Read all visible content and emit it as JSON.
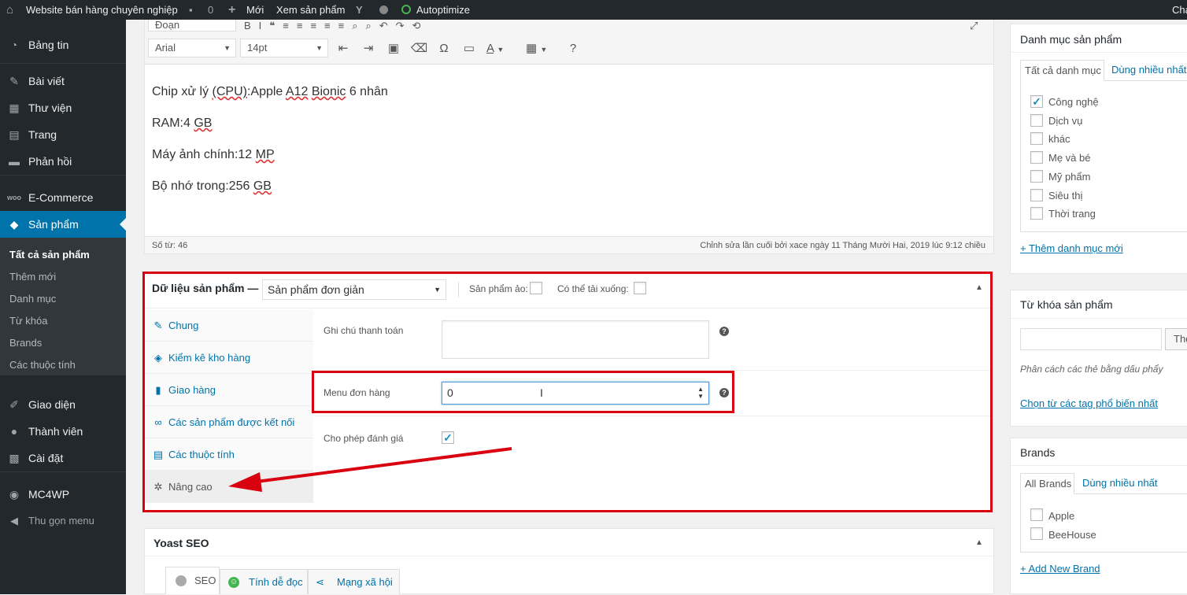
{
  "adminbar": {
    "site_name": "Website bán hàng chuyên nghiệp",
    "comments": "0",
    "new": "Mới",
    "view": "Xem sản phẩm",
    "autoptimize": "Autoptimize",
    "right": "Cha"
  },
  "sidebar": {
    "items": [
      {
        "label": "Bảng tin",
        "icon": "dashboard-icon"
      },
      {
        "label": "Bài viết",
        "icon": "pin-icon"
      },
      {
        "label": "Thư viện",
        "icon": "media-icon"
      },
      {
        "label": "Trang",
        "icon": "page-icon"
      },
      {
        "label": "Phản hồi",
        "icon": "comment-icon"
      },
      {
        "label": "E-Commerce",
        "icon": "woo-icon"
      },
      {
        "label": "Sản phẩm",
        "icon": "cube-icon"
      },
      {
        "label": "Giao diện",
        "icon": "brush-icon"
      },
      {
        "label": "Thành viên",
        "icon": "user-icon"
      },
      {
        "label": "Cài đặt",
        "icon": "settings-icon"
      },
      {
        "label": "MC4WP",
        "icon": "mc4wp-icon"
      },
      {
        "label": "Thu gọn menu",
        "icon": "collapse-icon"
      }
    ],
    "submenu": [
      "Tất cả sản phẩm",
      "Thêm mới",
      "Danh mục",
      "Từ khóa",
      "Brands",
      "Các thuộc tính"
    ]
  },
  "editor": {
    "format": "Đoạn",
    "font": "Arial",
    "size": "14pt",
    "lines": [
      {
        "pre": "Chip xử lý ",
        "u1": "(CPU)",
        "mid": ":Apple ",
        "u2": "A12",
        "sp": " ",
        "u3": "Bionic",
        "post": " 6 nhân"
      },
      {
        "pre": "RAM:4 ",
        "u1": "GB"
      },
      {
        "pre": "Máy ảnh chính:12 ",
        "u1": "MP"
      },
      {
        "pre": "Bộ nhớ trong:256 ",
        "u1": "GB"
      }
    ],
    "word_count": "Số từ: 46",
    "last_edit": "Chỉnh sửa lần cuối bởi xace ngày 11 Tháng Mười Hai, 2019 lúc 9:12 chiều"
  },
  "product_data": {
    "title": "Dữ liệu sản phẩm —",
    "type": "Sản phẩm đơn giản",
    "virtual": "Sản phẩm ảo:",
    "downloadable": "Có thể tải xuống:",
    "tabs": [
      "Chung",
      "Kiểm kê kho hàng",
      "Giao hàng",
      "Các sản phẩm được kết nối",
      "Các thuộc tính",
      "Nâng cao"
    ],
    "purchase_note": "Ghi chú thanh toán",
    "menu_order": "Menu đơn hàng",
    "menu_order_value": "0",
    "reviews": "Cho phép đánh giá"
  },
  "yoast": {
    "title": "Yoast SEO",
    "tabs": [
      "SEO",
      "Tính dễ đọc",
      "Mạng xã hội"
    ]
  },
  "categories": {
    "title": "Danh mục sản phẩm",
    "tab_all": "Tất cả danh mục",
    "tab_popular": "Dùng nhiều nhất",
    "items": [
      {
        "label": "Công nghệ",
        "checked": true
      },
      {
        "label": "Dịch vụ",
        "checked": false
      },
      {
        "label": "khác",
        "checked": false
      },
      {
        "label": "Mẹ và bé",
        "checked": false
      },
      {
        "label": "Mỹ phẩm",
        "checked": false
      },
      {
        "label": "Siêu thị",
        "checked": false
      },
      {
        "label": "Thời trang",
        "checked": false
      }
    ],
    "add_new": "+ Thêm danh mục mới"
  },
  "tags": {
    "title": "Từ khóa sản phẩm",
    "button": "The",
    "hint": "Phân cách các thẻ bằng dấu phẩy",
    "choose": "Chọn từ các tag phổ biến nhất"
  },
  "brands": {
    "title": "Brands",
    "tab_all": "All Brands",
    "tab_popular": "Dùng nhiều nhất",
    "items": [
      "Apple",
      "BeeHouse"
    ],
    "add_new": "+ Add New Brand"
  },
  "colors": {
    "accent": "#0073aa",
    "annotation": "#d9000f"
  }
}
